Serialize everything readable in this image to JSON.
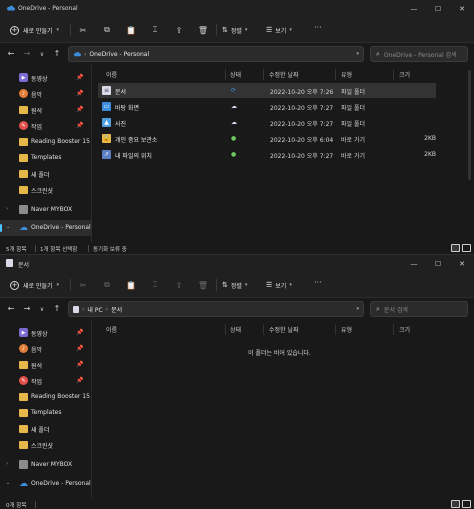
{
  "win1": {
    "title": "OneDrive - Personal",
    "toolbar": {
      "new_label": "새로 만들기",
      "sort_label": "정렬",
      "view_label": "보기"
    },
    "address": {
      "crumbs": [
        "OneDrive - Personal"
      ],
      "search_placeholder": "OneDrive - Personal 검색"
    },
    "sidebar": [
      {
        "label": "동영상",
        "pinned": true
      },
      {
        "label": "음악",
        "pinned": true
      },
      {
        "label": "원석",
        "pinned": true
      },
      {
        "label": "작업",
        "pinned": true
      },
      {
        "label": "Reading Booster 15",
        "pinned": false
      },
      {
        "label": "Templates",
        "pinned": false
      },
      {
        "label": "새 폴더",
        "pinned": false
      },
      {
        "label": "스크린샷",
        "pinned": false
      },
      {
        "label": "Naver MYBOX",
        "pinned": false
      },
      {
        "label": "OneDrive - Personal",
        "pinned": false
      }
    ],
    "columns": {
      "name": "이름",
      "status": "상태",
      "date": "수정한 날짜",
      "type": "유형",
      "size": "크기"
    },
    "rows": [
      {
        "name": "문서",
        "status": "sync-icon",
        "date": "2022-10-20 오후 7:26",
        "type": "파일 폴더",
        "size": ""
      },
      {
        "name": "바탕 화면",
        "status": "cloud-icon",
        "date": "2022-10-20 오후 7:27",
        "type": "파일 폴더",
        "size": ""
      },
      {
        "name": "사진",
        "status": "cloud-icon",
        "date": "2022-10-20 오후 7:27",
        "type": "파일 폴더",
        "size": ""
      },
      {
        "name": "개인 중요 보관소",
        "status": "available-icon",
        "date": "2022-10-20 오후 6:04",
        "type": "바로 가기",
        "size": "2KB"
      },
      {
        "name": "내 파일의 위치",
        "status": "available-icon",
        "date": "2022-10-20 오후 7:27",
        "type": "바로 가기",
        "size": "2KB"
      }
    ],
    "status": {
      "items": "5개 항목",
      "selected": "1개 항목 선택함",
      "sync": "동기화 보류 중"
    }
  },
  "win2": {
    "title": "문서",
    "toolbar": {
      "new_label": "새로 만들기",
      "sort_label": "정렬",
      "view_label": "보기"
    },
    "address": {
      "crumbs": [
        "내 PC",
        "문서"
      ],
      "search_placeholder": "문서 검색"
    },
    "sidebar": [
      {
        "label": "동영상",
        "pinned": true
      },
      {
        "label": "음악",
        "pinned": true
      },
      {
        "label": "원석",
        "pinned": true
      },
      {
        "label": "작업",
        "pinned": true
      },
      {
        "label": "Reading Booster 15",
        "pinned": false
      },
      {
        "label": "Templates",
        "pinned": false
      },
      {
        "label": "새 폴더",
        "pinned": false
      },
      {
        "label": "스크린샷",
        "pinned": false
      },
      {
        "label": "Naver MYBOX",
        "pinned": false
      },
      {
        "label": "OneDrive - Personal",
        "pinned": false
      }
    ],
    "columns": {
      "name": "이름",
      "status": "상태",
      "date": "수정한 날짜",
      "type": "유형",
      "size": "크기"
    },
    "empty_message": "이 폴더는 비어 있습니다.",
    "status": {
      "items": "0개 항목"
    }
  },
  "colors": {
    "accent": "#4cc2ff",
    "sync_blue": "#3c8ddd",
    "ok_green": "#6ccb5f",
    "folder": "#e8b74a"
  }
}
